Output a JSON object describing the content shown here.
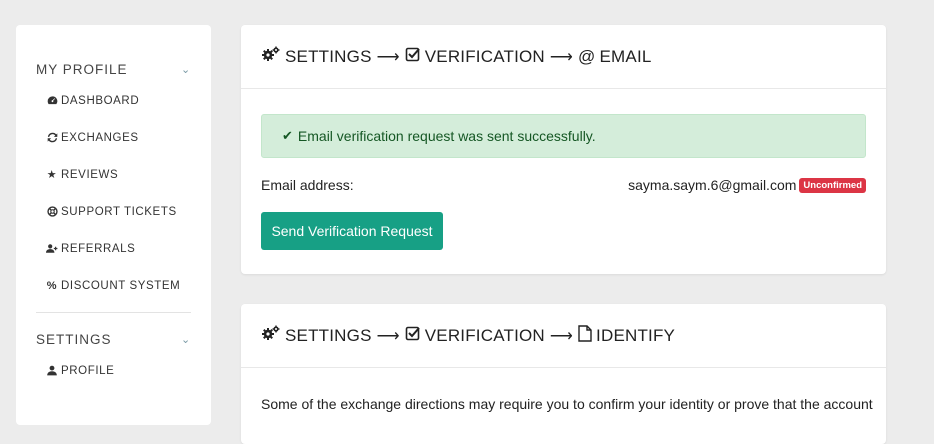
{
  "sidebar": {
    "sections": [
      {
        "title": "MY PROFILE",
        "items": [
          {
            "icon": "dashboard-icon",
            "glyph": "◔",
            "label": "DASHBOARD"
          },
          {
            "icon": "refresh-icon",
            "glyph": "⟳",
            "label": "EXCHANGES"
          },
          {
            "icon": "star-icon",
            "glyph": "★",
            "label": "REVIEWS"
          },
          {
            "icon": "life-ring-icon",
            "glyph": "⊕",
            "label": "SUPPORT TICKETS"
          },
          {
            "icon": "user-plus-icon",
            "glyph": "👤",
            "label": "REFERRALS"
          },
          {
            "icon": "percent-icon",
            "glyph": "%",
            "label": "DISCOUNT SYSTEM"
          }
        ]
      },
      {
        "title": "SETTINGS",
        "items": [
          {
            "icon": "user-icon",
            "glyph": "👤",
            "label": "PROFILE"
          }
        ]
      }
    ]
  },
  "email_card": {
    "breadcrumb": {
      "settings": "SETTINGS",
      "verification": "VERIFICATION",
      "email": "EMAIL",
      "arrow": "⟶"
    },
    "alert": "Email verification request was sent successfully.",
    "email_label": "Email address:",
    "email_value": "sayma.saym.6@gmail.com",
    "status_badge": "Unconfirmed",
    "button": "Send Verification Request"
  },
  "identify_card": {
    "breadcrumb": {
      "settings": "SETTINGS",
      "verification": "VERIFICATION",
      "identify": "IDENTIFY",
      "arrow": "⟶"
    },
    "text": "Some of the exchange directions may require you to confirm your identity or prove that the account"
  },
  "colors": {
    "accent": "#17a085",
    "success_bg": "#d4edda",
    "success_text": "#155724",
    "danger": "#dc3545",
    "page_bg": "#ececec"
  }
}
